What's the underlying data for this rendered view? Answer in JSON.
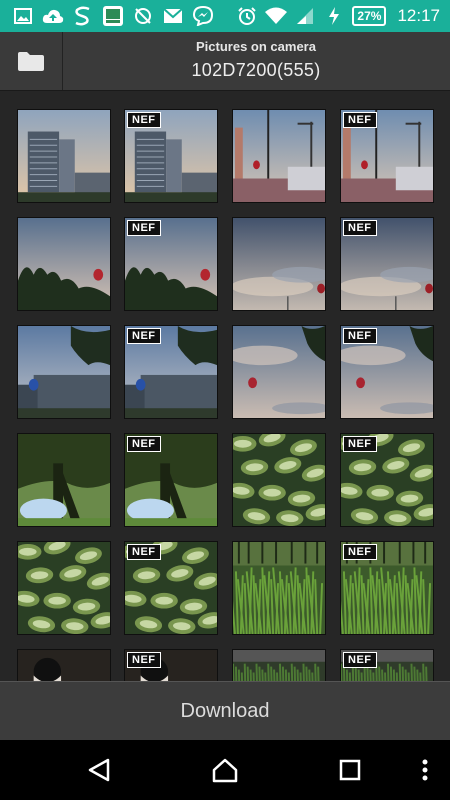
{
  "status_bar": {
    "notification_icons": [
      "image-icon",
      "cloud-upload-icon",
      "s-app-icon",
      "nikon-app-icon",
      "sync-off-icon",
      "gmail-icon",
      "messenger-icon"
    ],
    "status_icons": [
      "alarm-icon",
      "wifi-icon",
      "signal-icon",
      "charging-icon"
    ],
    "battery": "27%",
    "time": "12:17",
    "background_color": "#1ab09a"
  },
  "header": {
    "subtitle": "Pictures on camera",
    "title": "102D7200(555)",
    "folder_icon": "folder-icon"
  },
  "grid": {
    "badge_label": "NEF",
    "thumbnails": [
      {
        "scene": "building",
        "nef": false
      },
      {
        "scene": "building",
        "nef": true
      },
      {
        "scene": "streetlamp-balloon",
        "nef": false
      },
      {
        "scene": "streetlamp-balloon",
        "nef": true
      },
      {
        "scene": "tree-balloon",
        "nef": false
      },
      {
        "scene": "tree-balloon",
        "nef": true
      },
      {
        "scene": "cloud-sky",
        "nef": false
      },
      {
        "scene": "cloud-sky",
        "nef": true
      },
      {
        "scene": "balloon-building",
        "nef": false
      },
      {
        "scene": "balloon-building",
        "nef": true
      },
      {
        "scene": "sky-balloon",
        "nef": false
      },
      {
        "scene": "sky-balloon",
        "nef": true
      },
      {
        "scene": "trees",
        "nef": false
      },
      {
        "scene": "trees",
        "nef": true
      },
      {
        "scene": "leaves",
        "nef": false
      },
      {
        "scene": "leaves",
        "nef": true
      },
      {
        "scene": "leaves",
        "nef": false
      },
      {
        "scene": "leaves",
        "nef": true
      },
      {
        "scene": "grass",
        "nef": false
      },
      {
        "scene": "grass",
        "nef": true
      },
      {
        "scene": "dark-person",
        "nef": false
      },
      {
        "scene": "dark-person",
        "nef": true
      },
      {
        "scene": "dark-grass",
        "nef": false
      },
      {
        "scene": "dark-grass",
        "nef": true
      }
    ]
  },
  "footer": {
    "download_label": "Download"
  },
  "nav_bar": {
    "buttons": [
      "back-icon",
      "home-icon",
      "recents-icon",
      "menu-icon"
    ]
  }
}
